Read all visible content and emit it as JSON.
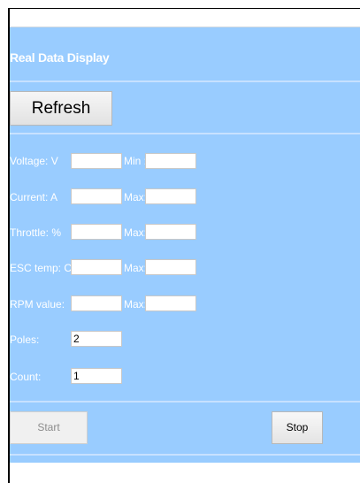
{
  "title": "Real Data Display",
  "refresh_label": "Refresh",
  "rows": [
    {
      "label": "Voltage: V",
      "value": "",
      "limit_label": "Min :",
      "limit_value": ""
    },
    {
      "label": "Current: A",
      "value": "",
      "limit_label": "Max:",
      "limit_value": ""
    },
    {
      "label": "Throttle: %",
      "value": "",
      "limit_label": "Max:",
      "limit_value": ""
    },
    {
      "label": "ESC temp: C",
      "value": "",
      "limit_label": "Max:",
      "limit_value": ""
    },
    {
      "label": "RPM value:",
      "value": "",
      "limit_label": "Max:",
      "limit_value": ""
    }
  ],
  "poles": {
    "label": "Poles:",
    "value": "2"
  },
  "count": {
    "label": "Count:",
    "value": "1"
  },
  "start_label": "Start",
  "stop_label": "Stop",
  "colors": {
    "panel": "#99ccff",
    "label_text": "#ffffff"
  }
}
